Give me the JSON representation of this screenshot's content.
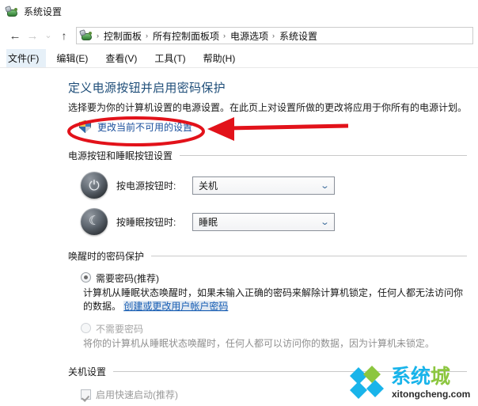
{
  "window": {
    "title": "系统设置",
    "icon": "control-panel-icon"
  },
  "nav": {
    "back_icon": "arrow-left-icon",
    "forward_icon": "arrow-right-icon",
    "recent_icon": "chevron-down-icon",
    "up_icon": "arrow-up-icon",
    "breadcrumb": [
      "控制面板",
      "所有控制面板项",
      "电源选项",
      "系统设置"
    ],
    "separator": "›"
  },
  "menubar": [
    {
      "label": "文件(F)",
      "active": true
    },
    {
      "label": "编辑(E)",
      "active": false
    },
    {
      "label": "查看(V)",
      "active": false
    },
    {
      "label": "工具(T)",
      "active": false
    },
    {
      "label": "帮助(H)",
      "active": false
    }
  ],
  "page": {
    "title": "定义电源按钮并启用密码保护",
    "description": "选择要为你的计算机设置的电源设置。在此页上对设置所做的更改将应用于你所有的电源计划。",
    "uac_link": {
      "label": "更改当前不可用的设置",
      "icon": "uac-shield-icon"
    }
  },
  "power_buttons_section": {
    "heading": "电源按钮和睡眠按钮设置",
    "rows": [
      {
        "icon": "power-button-icon",
        "glyph": "⏻",
        "label": "按电源按钮时:",
        "value": "关机",
        "caret": "⌄"
      },
      {
        "icon": "sleep-moon-icon",
        "glyph": "☾",
        "label": "按睡眠按钮时:",
        "value": "睡眠",
        "caret": "⌄"
      }
    ]
  },
  "password_section": {
    "heading": "唤醒时的密码保护",
    "options": [
      {
        "title": "需要密码(推荐)",
        "selected": true,
        "body_prefix": "计算机从睡眠状态唤醒时，如果未输入正确的密码来解除计算机锁定，任何人都无法访问你的数据。",
        "body_link": "创建或更改用户帐户密码"
      },
      {
        "title": "不需要密码",
        "selected": false,
        "body_prefix": "将你的计算机从睡眠状态唤醒时，任何人都可以访问你的数据，因为计算机未锁定。",
        "body_link": ""
      }
    ]
  },
  "shutdown_section": {
    "heading": "关机设置",
    "checkbox": {
      "label": "启用快速启动(推荐)",
      "checked": true,
      "disabled": true
    }
  },
  "annotation": {
    "color": "#e2121a",
    "shapes": "ellipse-around-uac-link, left-pointing-arrow"
  },
  "watermark": {
    "text_part1": "系统",
    "text_part2": "城",
    "subtitle": "xitongcheng.com",
    "color_blue": "#19b4ea",
    "color_green": "#8cc63f"
  }
}
